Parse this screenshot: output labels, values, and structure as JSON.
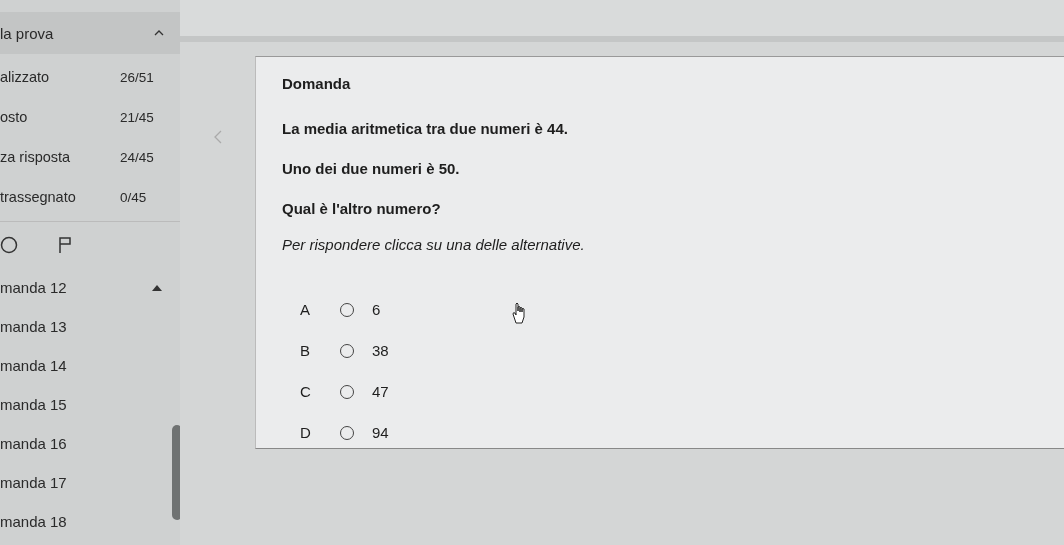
{
  "sidebar": {
    "header": {
      "title": "la prova",
      "expanded": true
    },
    "stats": [
      {
        "label": "alizzato",
        "value": "26/51"
      },
      {
        "label": "osto",
        "value": "21/45"
      },
      {
        "label": "za risposta",
        "value": "24/45"
      },
      {
        "label": "trassegnato",
        "value": "0/45"
      }
    ],
    "questions": [
      {
        "label": "manda 12",
        "selected": true
      },
      {
        "label": "manda 13",
        "selected": false
      },
      {
        "label": "manda 14",
        "selected": false
      },
      {
        "label": "manda 15",
        "selected": false
      },
      {
        "label": "manda 16",
        "selected": false
      },
      {
        "label": "manda 17",
        "selected": false
      },
      {
        "label": "manda 18",
        "selected": false
      }
    ]
  },
  "question": {
    "heading": "Domanda",
    "lines": [
      "La media aritmetica tra due numeri è 44.",
      "Uno dei due numeri è 50.",
      "Qual è l'altro numero?"
    ],
    "instruction": "Per rispondere clicca su una delle alternative.",
    "options": [
      {
        "letter": "A",
        "value": "6",
        "selected": false
      },
      {
        "letter": "B",
        "value": "38",
        "selected": false
      },
      {
        "letter": "C",
        "value": "47",
        "selected": false
      },
      {
        "letter": "D",
        "value": "94",
        "selected": false
      }
    ]
  }
}
